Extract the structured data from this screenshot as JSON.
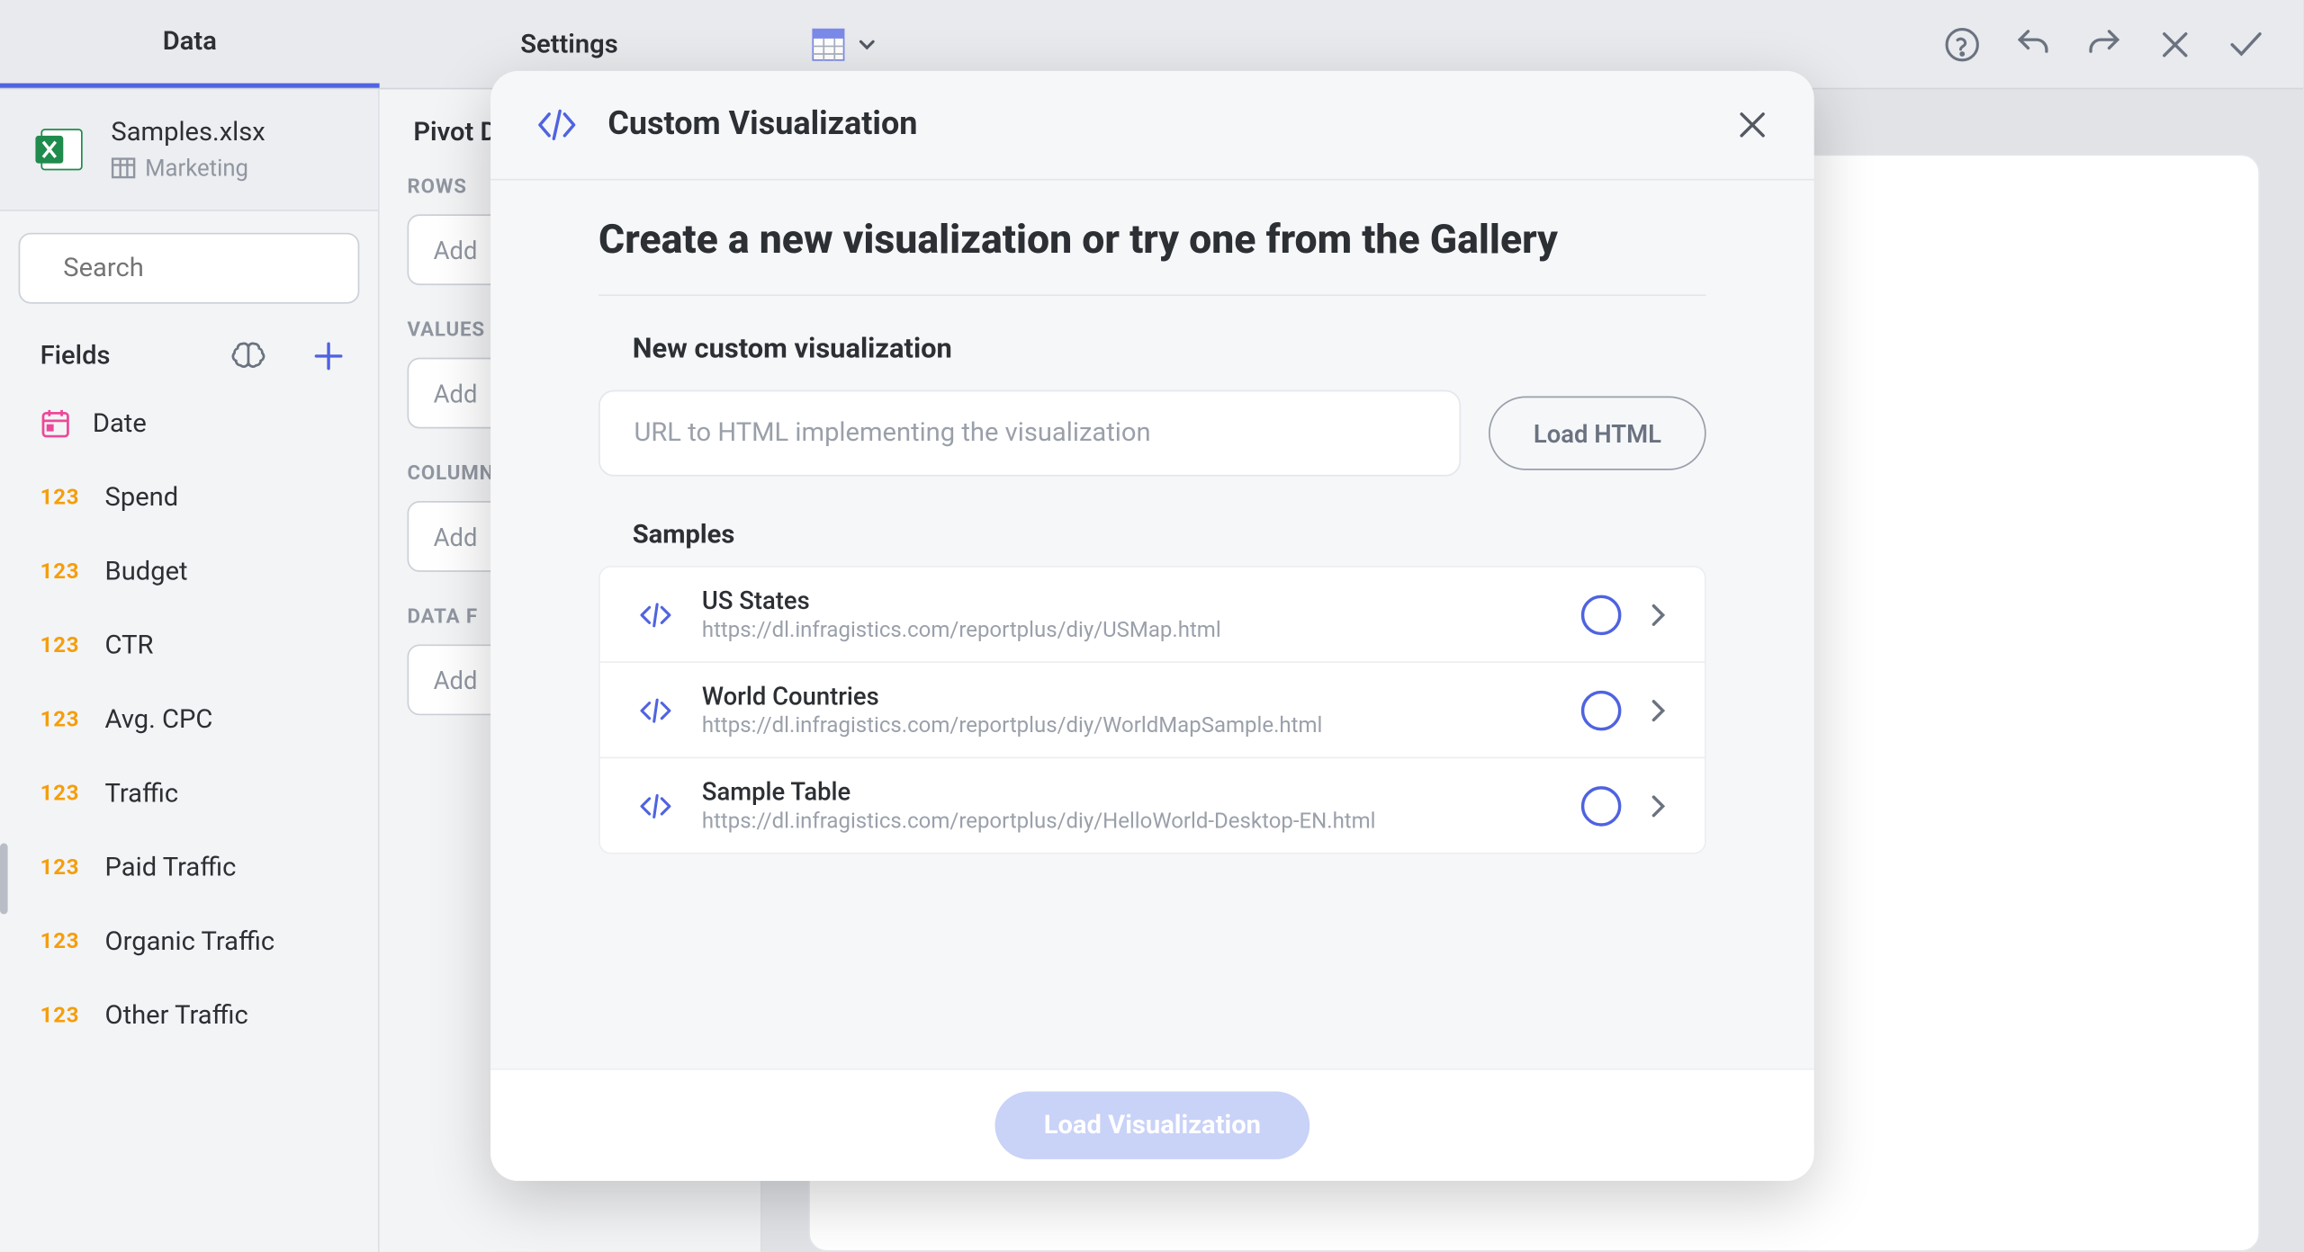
{
  "tabs": {
    "data": "Data",
    "settings": "Settings"
  },
  "datasource": {
    "name": "Samples.xlsx",
    "sheet": "Marketing"
  },
  "search": {
    "placeholder": "Search"
  },
  "fields": {
    "label": "Fields",
    "items": [
      {
        "type": "date",
        "name": "Date"
      },
      {
        "type": "123",
        "name": "Spend"
      },
      {
        "type": "123",
        "name": "Budget"
      },
      {
        "type": "123",
        "name": "CTR"
      },
      {
        "type": "123",
        "name": "Avg. CPC"
      },
      {
        "type": "123",
        "name": "Traffic"
      },
      {
        "type": "123",
        "name": "Paid Traffic"
      },
      {
        "type": "123",
        "name": "Organic Traffic"
      },
      {
        "type": "123",
        "name": "Other Traffic"
      }
    ]
  },
  "pivot": {
    "title": "Pivot D",
    "rows": "ROWS",
    "values": "VALUES",
    "columns": "COLUMN",
    "datafilters": "DATA F",
    "add": "Add"
  },
  "modal": {
    "title": "Custom Visualization",
    "heading": "Create a new visualization or try one from the Gallery",
    "newSection": "New custom visualization",
    "urlPlaceholder": "URL to HTML implementing the visualization",
    "loadHtml": "Load HTML",
    "samplesHead": "Samples",
    "samples": [
      {
        "name": "US States",
        "url": "https://dl.infragistics.com/reportplus/diy/USMap.html"
      },
      {
        "name": "World Countries",
        "url": "https://dl.infragistics.com/reportplus/diy/WorldMapSample.html"
      },
      {
        "name": "Sample Table",
        "url": "https://dl.infragistics.com/reportplus/diy/HelloWorld-Desktop-EN.html"
      }
    ],
    "loadViz": "Load Visualization"
  }
}
